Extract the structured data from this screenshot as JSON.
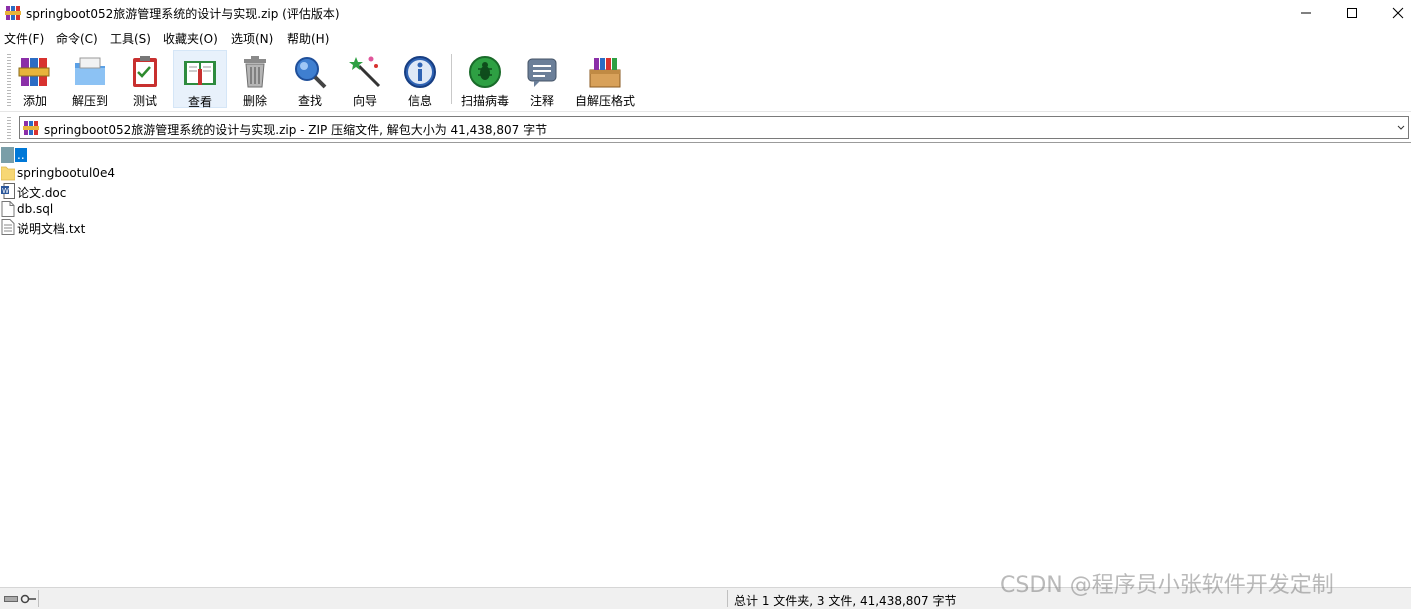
{
  "window": {
    "title": "springboot052旅游管理系统的设计与实现.zip (评估版本)"
  },
  "menu": [
    {
      "label": "文件(F)"
    },
    {
      "label": "命令(C)"
    },
    {
      "label": "工具(S)"
    },
    {
      "label": "收藏夹(O)"
    },
    {
      "label": "选项(N)"
    },
    {
      "label": "帮助(H)"
    }
  ],
  "toolbar": {
    "buttons": [
      {
        "label": "添加",
        "icon": "books-add-icon"
      },
      {
        "label": "解压到",
        "icon": "folder-extract-icon"
      },
      {
        "label": "测试",
        "icon": "clipboard-check-icon"
      },
      {
        "label": "查看",
        "icon": "open-book-icon"
      },
      {
        "label": "删除",
        "icon": "trash-can-icon"
      },
      {
        "label": "查找",
        "icon": "magnifier-icon"
      },
      {
        "label": "向导",
        "icon": "magic-wand-icon"
      },
      {
        "label": "信息",
        "icon": "info-icon"
      },
      {
        "label": "扫描病毒",
        "icon": "virus-scan-icon"
      },
      {
        "label": "注释",
        "icon": "comment-icon"
      },
      {
        "label": "自解压格式",
        "icon": "sfx-box-icon"
      }
    ],
    "active_index": 3
  },
  "address": {
    "text": "springboot052旅游管理系统的设计与实现.zip - ZIP 压缩文件, 解包大小为 41,438,807 字节"
  },
  "files": [
    {
      "name": "..",
      "type": "parent",
      "selected": true
    },
    {
      "name": "springbootul0e4",
      "type": "folder",
      "selected": false
    },
    {
      "name": "论文.doc",
      "type": "word",
      "selected": false
    },
    {
      "name": "db.sql",
      "type": "file",
      "selected": false
    },
    {
      "name": "说明文档.txt",
      "type": "text",
      "selected": false
    }
  ],
  "status": {
    "summary": "总计 1 文件夹, 3 文件, 41,438,807 字节"
  },
  "watermark": "CSDN @程序员小张软件开发定制",
  "colors": {
    "selection": "#0078d7",
    "folder": "#f7d774"
  }
}
